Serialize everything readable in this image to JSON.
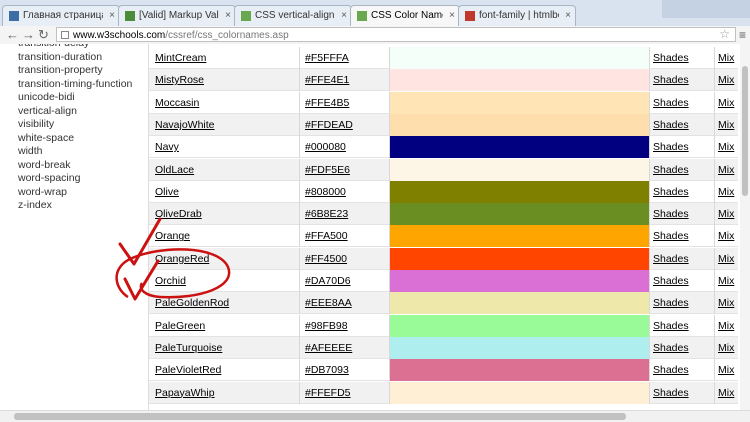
{
  "tabs": [
    {
      "label": "Главная страница «",
      "active": false
    },
    {
      "label": "[Valid] Markup Valid",
      "active": false
    },
    {
      "label": "CSS vertical-align p",
      "active": false
    },
    {
      "label": "CSS Color Names",
      "active": true
    },
    {
      "label": "font-family | htmlbo",
      "active": false
    }
  ],
  "toolbar": {
    "url_host": "www.w3schools.com",
    "url_path": "/cssref/css_colornames.asp"
  },
  "sidebar": {
    "items": [
      "transition-delay",
      "transition-duration",
      "transition-property",
      "transition-timing-function",
      "unicode-bidi",
      "vertical-align",
      "visibility",
      "white-space",
      "width",
      "word-break",
      "word-spacing",
      "word-wrap",
      "z-index"
    ]
  },
  "table": {
    "rows": [
      {
        "name": "MintCream",
        "hex": "#F5FFFA",
        "color": "#F5FFFA",
        "shades": "Shades",
        "mix": "Mix"
      },
      {
        "name": "MistyRose",
        "hex": "#FFE4E1",
        "color": "#FFE4E1",
        "shades": "Shades",
        "mix": "Mix"
      },
      {
        "name": "Moccasin",
        "hex": "#FFE4B5",
        "color": "#FFE4B5",
        "shades": "Shades",
        "mix": "Mix"
      },
      {
        "name": "NavajoWhite",
        "hex": "#FFDEAD",
        "color": "#FFDEAD",
        "shades": "Shades",
        "mix": "Mix"
      },
      {
        "name": "Navy",
        "hex": "#000080",
        "color": "#000080",
        "shades": "Shades",
        "mix": "Mix"
      },
      {
        "name": "OldLace",
        "hex": "#FDF5E6",
        "color": "#FDF5E6",
        "shades": "Shades",
        "mix": "Mix"
      },
      {
        "name": "Olive",
        "hex": "#808000",
        "color": "#808000",
        "shades": "Shades",
        "mix": "Mix"
      },
      {
        "name": "OliveDrab",
        "hex": "#6B8E23",
        "color": "#6B8E23",
        "shades": "Shades",
        "mix": "Mix"
      },
      {
        "name": "Orange",
        "hex": "#FFA500",
        "color": "#FFA500",
        "shades": "Shades",
        "mix": "Mix"
      },
      {
        "name": "OrangeRed",
        "hex": "#FF4500",
        "color": "#FF4500",
        "shades": "Shades",
        "mix": "Mix"
      },
      {
        "name": "Orchid",
        "hex": "#DA70D6",
        "color": "#DA70D6",
        "shades": "Shades",
        "mix": "Mix"
      },
      {
        "name": "PaleGoldenRod",
        "hex": "#EEE8AA",
        "color": "#EEE8AA",
        "shades": "Shades",
        "mix": "Mix"
      },
      {
        "name": "PaleGreen",
        "hex": "#98FB98",
        "color": "#98FB98",
        "shades": "Shades",
        "mix": "Mix"
      },
      {
        "name": "PaleTurquoise",
        "hex": "#AFEEEE",
        "color": "#AFEEEE",
        "shades": "Shades",
        "mix": "Mix"
      },
      {
        "name": "PaleVioletRed",
        "hex": "#DB7093",
        "color": "#DB7093",
        "shades": "Shades",
        "mix": "Mix"
      },
      {
        "name": "PapayaWhip",
        "hex": "#FFEFD5",
        "color": "#FFEFD5",
        "shades": "Shades",
        "mix": "Mix"
      }
    ]
  },
  "colors": {
    "annotation": "#cc1111",
    "tabstrip": "#d9e3ef"
  },
  "icons": {
    "back": "back-arrow-icon",
    "forward": "forward-arrow-icon",
    "reload": "reload-icon",
    "star": "bookmark-star-icon",
    "menu": "wrench-menu-icon"
  }
}
